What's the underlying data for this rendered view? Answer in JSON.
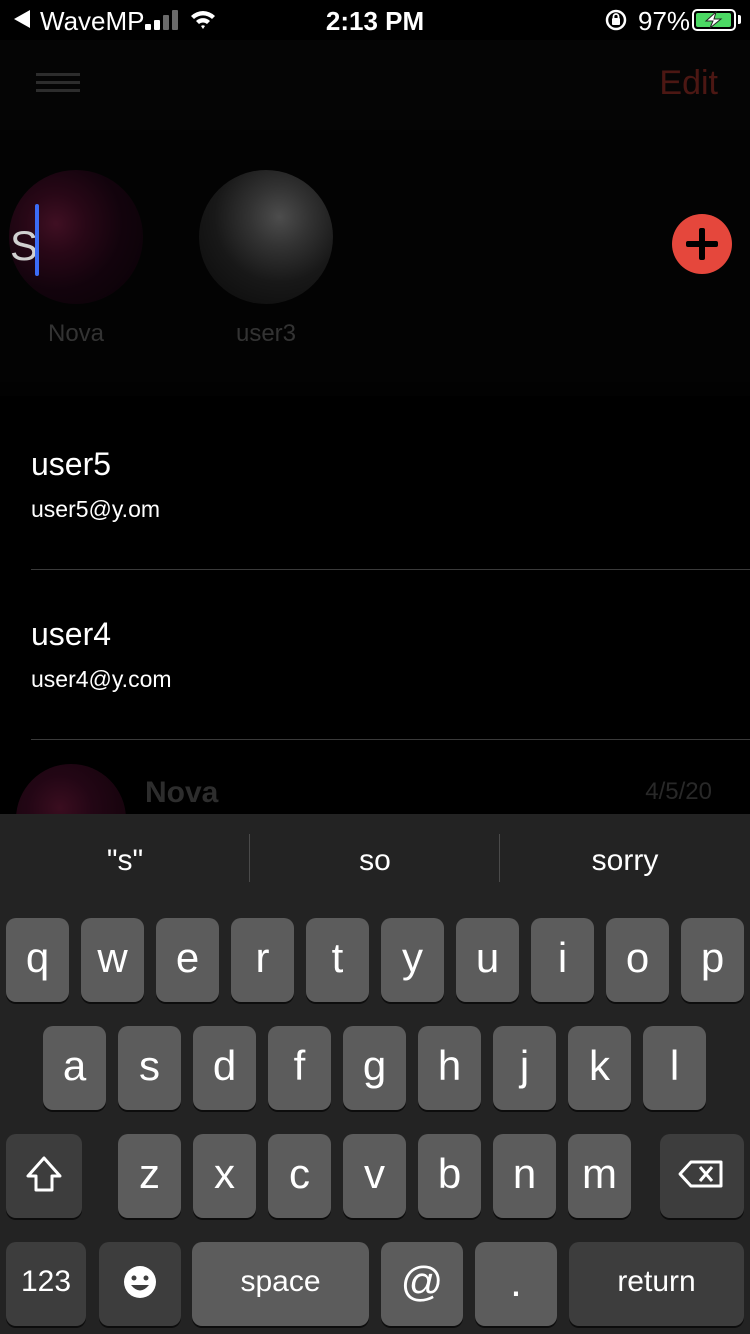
{
  "status_bar": {
    "carrier": "WaveMP",
    "time": "2:13 PM",
    "battery_percent": "97%",
    "battery_level": 0.97,
    "colors": {
      "battery_fill": "#4cd964"
    }
  },
  "nav": {
    "edit_label": "Edit",
    "menu_icon": "hamburger-menu-icon"
  },
  "stories": [
    {
      "name": "Nova"
    },
    {
      "name": "user3"
    }
  ],
  "search": {
    "value": "S"
  },
  "add_button": {
    "icon": "plus-icon",
    "color": "#e5473c"
  },
  "results": [
    {
      "name": "user5",
      "email": "user5@y.om"
    },
    {
      "name": "user4",
      "email": "user4@y.com"
    }
  ],
  "chat_preview": {
    "name": "Nova",
    "date": "4/5/20"
  },
  "keyboard": {
    "suggestions": [
      "\"s\"",
      "so",
      "sorry"
    ],
    "row1": [
      "q",
      "w",
      "e",
      "r",
      "t",
      "y",
      "u",
      "i",
      "o",
      "p"
    ],
    "row2": [
      "a",
      "s",
      "d",
      "f",
      "g",
      "h",
      "j",
      "k",
      "l"
    ],
    "row3": [
      "z",
      "x",
      "c",
      "v",
      "b",
      "n",
      "m"
    ],
    "numbers_label": "123",
    "space_label": "space",
    "at_label": "@",
    "period_label": ".",
    "return_label": "return",
    "icons": [
      "shift-icon",
      "delete-icon",
      "emoji-icon"
    ]
  }
}
